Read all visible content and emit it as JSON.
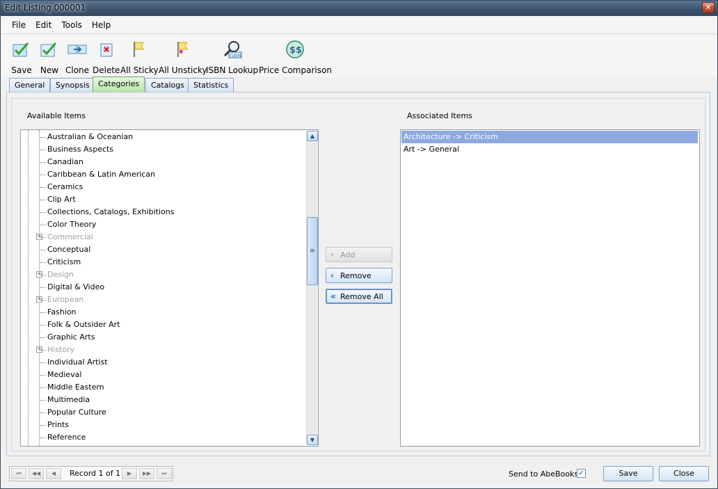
{
  "window": {
    "title": "Edit Listing 000001",
    "close_glyph": "✕"
  },
  "menu": {
    "items": [
      "File",
      "Edit",
      "Tools",
      "Help"
    ]
  },
  "toolbar": {
    "items": [
      {
        "label": "Save",
        "icon": "save-check-icon"
      },
      {
        "label": "New",
        "icon": "new-check-icon"
      },
      {
        "label": "Clone",
        "icon": "clone-icon"
      },
      {
        "label": "Delete",
        "icon": "delete-icon"
      },
      {
        "label": "All Sticky",
        "icon": "sticky-flag-icon"
      },
      {
        "label": "All Unsticky",
        "icon": "unsticky-flag-icon"
      },
      {
        "label": "ISBN Lookup",
        "icon": "isbn-magnifier-icon"
      },
      {
        "label": "Price Comparison",
        "icon": "price-comparison-icon"
      }
    ]
  },
  "tabs": {
    "items": [
      "General",
      "Synopsis",
      "Categories",
      "Catalogs",
      "Statistics"
    ],
    "active": "Categories"
  },
  "available": {
    "label": "Available Items",
    "items": [
      {
        "text": "Australian & Oceanian",
        "expandable": false,
        "disabled": false
      },
      {
        "text": "Business Aspects",
        "expandable": false,
        "disabled": false
      },
      {
        "text": "Canadian",
        "expandable": false,
        "disabled": false
      },
      {
        "text": "Caribbean & Latin American",
        "expandable": false,
        "disabled": false
      },
      {
        "text": "Ceramics",
        "expandable": false,
        "disabled": false
      },
      {
        "text": "Clip Art",
        "expandable": false,
        "disabled": false
      },
      {
        "text": "Collections, Catalogs, Exhibitions",
        "expandable": false,
        "disabled": false
      },
      {
        "text": "Color Theory",
        "expandable": false,
        "disabled": false
      },
      {
        "text": "Commercial",
        "expandable": true,
        "disabled": true
      },
      {
        "text": "Conceptual",
        "expandable": false,
        "disabled": false
      },
      {
        "text": "Criticism",
        "expandable": false,
        "disabled": false
      },
      {
        "text": "Design",
        "expandable": true,
        "disabled": true
      },
      {
        "text": "Digital & Video",
        "expandable": false,
        "disabled": false
      },
      {
        "text": "European",
        "expandable": true,
        "disabled": true
      },
      {
        "text": "Fashion",
        "expandable": false,
        "disabled": false
      },
      {
        "text": "Folk & Outsider Art",
        "expandable": false,
        "disabled": false
      },
      {
        "text": "Graphic Arts",
        "expandable": false,
        "disabled": false
      },
      {
        "text": "History",
        "expandable": true,
        "disabled": true
      },
      {
        "text": "Individual Artist",
        "expandable": false,
        "disabled": false
      },
      {
        "text": "Medieval",
        "expandable": false,
        "disabled": false
      },
      {
        "text": "Middle Eastern",
        "expandable": false,
        "disabled": false
      },
      {
        "text": "Multimedia",
        "expandable": false,
        "disabled": false
      },
      {
        "text": "Popular Culture",
        "expandable": false,
        "disabled": false
      },
      {
        "text": "Prints",
        "expandable": false,
        "disabled": false
      },
      {
        "text": "Reference",
        "expandable": false,
        "disabled": false
      }
    ]
  },
  "associated": {
    "label": "Associated Items",
    "items": [
      {
        "text": "Architecture -> Criticism",
        "selected": true
      },
      {
        "text": "Art -> General",
        "selected": false
      }
    ]
  },
  "actions": {
    "add": {
      "label": "Add",
      "disabled": true,
      "icon": "chevron-right-icon"
    },
    "remove": {
      "label": "Remove",
      "disabled": false,
      "icon": "chevron-left-icon"
    },
    "remove_all": {
      "label": "Remove All",
      "disabled": false,
      "icon": "double-chevron-left-icon"
    }
  },
  "footer": {
    "record_text": "Record 1 of 1",
    "send_label": "Send to AbeBooks:",
    "send_checked": true,
    "save_label": "Save",
    "close_label": "Close"
  },
  "colors": {
    "selected_row": "#8ea9e0",
    "active_tab": "#b8e6a8"
  }
}
